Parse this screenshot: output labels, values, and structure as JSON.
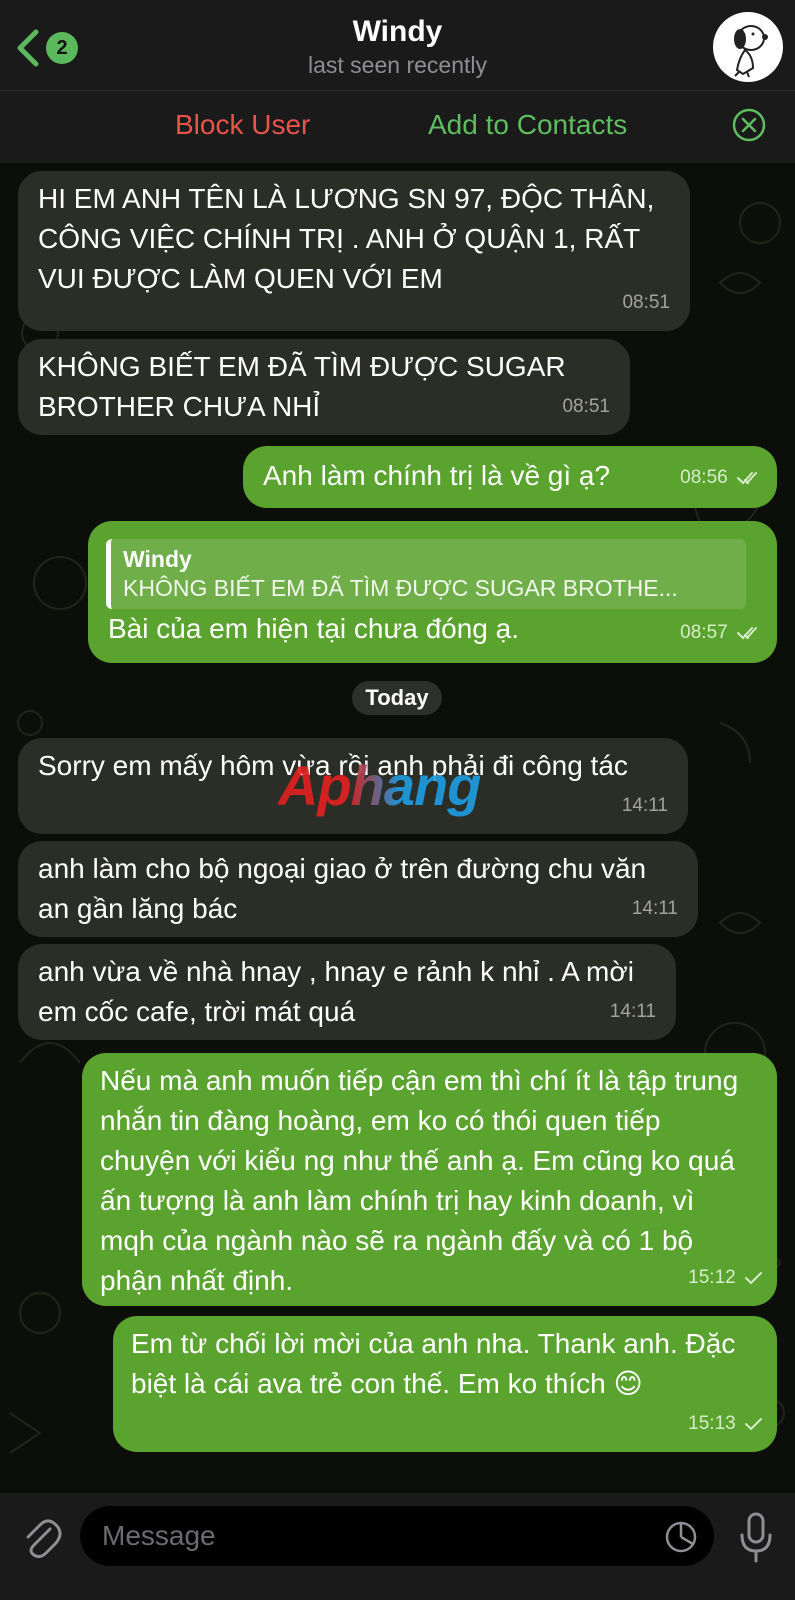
{
  "header": {
    "back_count": "2",
    "title": "Windy",
    "status": "last seen recently"
  },
  "actions": {
    "block": "Block User",
    "add": "Add to Contacts"
  },
  "messages": [
    {
      "side": "in",
      "text": "HI EM ANH TÊN LÀ LƯƠNG SN 97, ĐỘC THÂN, CÔNG VIỆC CHÍNH TRỊ . ANH Ở QUẬN 1, RẤT VUI ĐƯỢC LÀM QUEN VỚI EM",
      "time": "08:51"
    },
    {
      "side": "in",
      "text": "KHÔNG BIẾT EM ĐÃ TÌM ĐƯỢC SUGAR BROTHER CHƯA NHỈ",
      "time": "08:51"
    },
    {
      "side": "out",
      "text": "Anh làm chính trị là về gì ạ?",
      "time": "08:56",
      "read": true
    },
    {
      "side": "out",
      "reply_name": "Windy",
      "reply_text": "KHÔNG BIẾT EM ĐÃ TÌM ĐƯỢC SUGAR BROTHE...",
      "text": "Bài của em hiện tại chưa đóng ạ.",
      "time": "08:57",
      "read": true
    },
    {
      "side": "in",
      "text": "Sorry em mấy hôm vừa rồi anh phải đi công tác",
      "time": "14:11"
    },
    {
      "side": "in",
      "text": "anh làm cho bộ ngoại giao ở trên đường chu văn an gần lăng bác",
      "time": "14:11"
    },
    {
      "side": "in",
      "text": "anh vừa về nhà hnay , hnay e rảnh k nhỉ . A mời em cốc cafe, trời mát quá",
      "time": "14:11"
    },
    {
      "side": "out",
      "text": "Nếu mà anh muốn tiếp cận em thì chí ít là tập trung nhắn tin đàng hoàng, em ko có thói quen tiếp chuyện với kiểu ng như thế anh ạ. Em cũng ko quá ấn tượng là anh làm chính trị hay kinh doanh, vì mqh của ngành nào sẽ ra ngành đấy và có 1 bộ phận nhất định.",
      "time": "15:12",
      "read": false
    },
    {
      "side": "out",
      "text": "Em từ chối lời mời của anh nha. Thank anh. Đặc biệt là cái ava trẻ con thế. Em ko thích",
      "emoji": "😊",
      "time": "15:13",
      "read": false
    }
  ],
  "day_divider": "Today",
  "watermark": "Aphang",
  "input": {
    "placeholder": "Message"
  },
  "colors": {
    "incoming_bubble": "#2b2e27",
    "outgoing_bubble": "#5ba32f",
    "block_red": "#e8534a",
    "add_green": "#5fbd5f"
  }
}
